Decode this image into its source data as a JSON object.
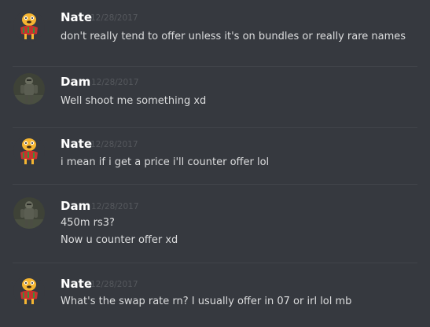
{
  "colors": {
    "background": "#36393f",
    "username": "#ffffff",
    "timestamp": "#55585d",
    "message_text": "#dcddde",
    "divider": "#41444a"
  },
  "messages": [
    {
      "author": "Nate",
      "avatar_icon": "jake-the-dog-avatar-icon",
      "timestamp": "12/28/2017",
      "lines": [
        "don't really tend to offer unless it's on bundles or really rare names"
      ]
    },
    {
      "author": "Dam",
      "avatar_icon": "armored-character-avatar-icon",
      "timestamp": "12/28/2017",
      "lines": [
        "Well shoot me something xd"
      ]
    },
    {
      "author": "Nate",
      "avatar_icon": "jake-the-dog-avatar-icon",
      "timestamp": "12/28/2017",
      "lines": [
        "i mean if i get a price i'll counter offer lol"
      ]
    },
    {
      "author": "Dam",
      "avatar_icon": "armored-character-avatar-icon",
      "timestamp": "12/28/2017",
      "lines": [
        "450m rs3?",
        "Now u counter offer xd"
      ]
    },
    {
      "author": "Nate",
      "avatar_icon": "jake-the-dog-avatar-icon",
      "timestamp": "12/28/2017",
      "lines": [
        "What's the swap rate rn? I usually offer in 07 or irl lol mb"
      ]
    }
  ]
}
